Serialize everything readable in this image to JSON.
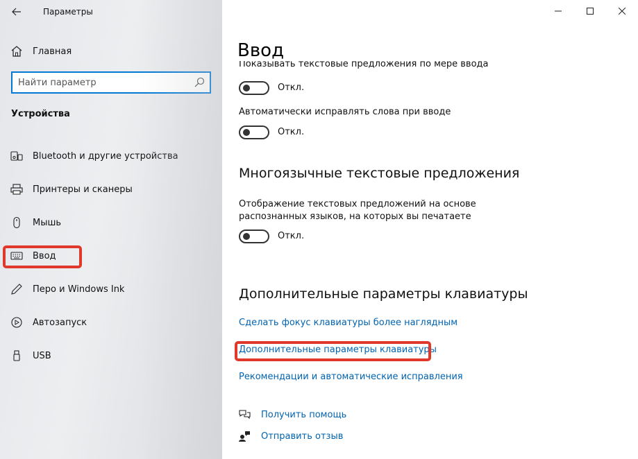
{
  "window": {
    "title": "Параметры"
  },
  "sidebar": {
    "home_label": "Главная",
    "search": {
      "placeholder": "Найти параметр",
      "value": ""
    },
    "section_title": "Устройства",
    "items": [
      {
        "label": "Bluetooth и другие устройства",
        "icon": "bluetooth-devices-icon"
      },
      {
        "label": "Принтеры и сканеры",
        "icon": "printer-icon"
      },
      {
        "label": "Мышь",
        "icon": "mouse-icon"
      },
      {
        "label": "Ввод",
        "icon": "keyboard-icon",
        "selected": true
      },
      {
        "label": "Перо и Windows Ink",
        "icon": "pen-icon"
      },
      {
        "label": "Автозапуск",
        "icon": "autoplay-icon"
      },
      {
        "label": "USB",
        "icon": "usb-icon"
      }
    ]
  },
  "main": {
    "page_title": "Ввод",
    "clipped_label": "Показывать текстовые предложения по мере ввода",
    "settings": [
      {
        "label": "Показывать текстовые предложения по мере ввода",
        "state": "Откл."
      },
      {
        "label": "Автоматически исправлять слова при вводе",
        "state": "Откл."
      }
    ],
    "multilingual": {
      "heading": "Многоязычные текстовые предложения",
      "description": "Отображение текстовых предложений на основе распознанных языков, на которых вы печатаете",
      "state": "Откл."
    },
    "advanced": {
      "heading": "Дополнительные параметры клавиатуры",
      "links": [
        "Сделать фокус клавиатуры более наглядным",
        "Дополнительные параметры клавиатуры",
        "Рекомендации и автоматические исправления"
      ]
    },
    "help": {
      "get_help": "Получить помощь",
      "feedback": "Отправить отзыв"
    }
  },
  "colors": {
    "accent": "#0078d4",
    "link": "#0063b1",
    "highlight": "#e0382b"
  }
}
